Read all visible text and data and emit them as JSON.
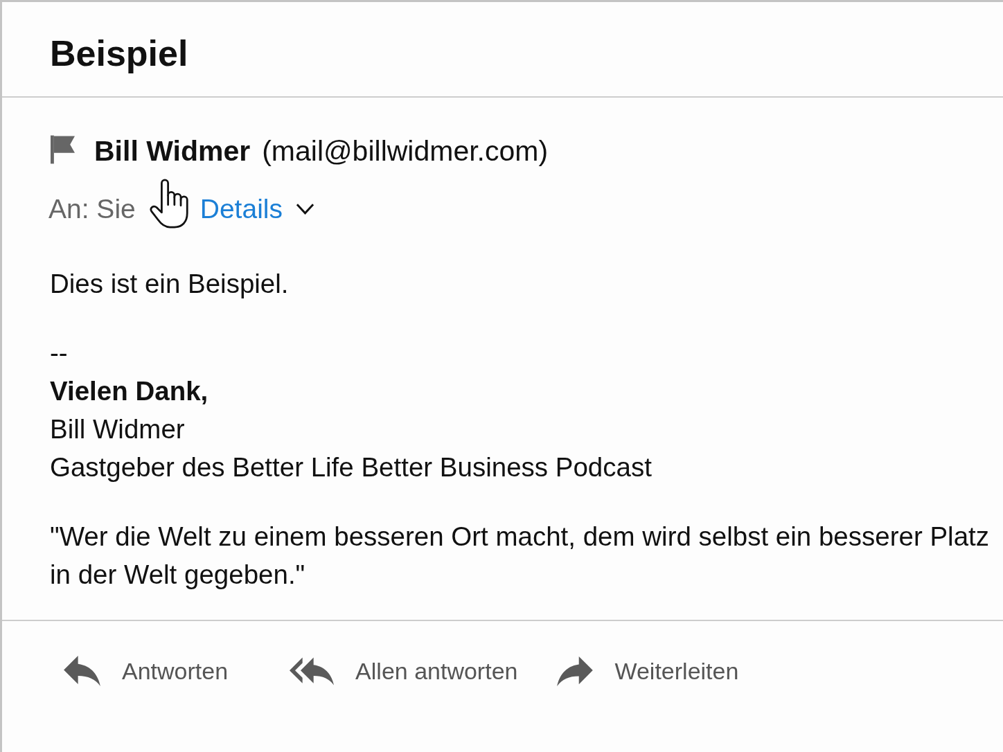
{
  "message": {
    "subject": "Beispiel",
    "sender": {
      "name": "Bill Widmer",
      "email": "(mail@billwidmer.com)"
    },
    "recipients": "An: Sie",
    "details": {
      "label": "Details",
      "expanded": false
    },
    "body": [
      {
        "lines": [
          {
            "text": "Dies ist ein Beispiel.",
            "bold": false
          }
        ]
      },
      {
        "lines": [
          {
            "text": "--",
            "bold": false
          },
          {
            "text": "Vielen Dank,",
            "bold": true
          },
          {
            "text": "Bill Widmer",
            "bold": false
          },
          {
            "text": "Gastgeber des Better Life Better Business Podcast",
            "bold": false
          }
        ]
      },
      {
        "lines": [
          {
            "text": "\"Wer die Welt zu einem besseren Ort macht, dem wird selbst ein besserer Platz in der Welt gegeben.\"",
            "bold": false
          }
        ]
      }
    ]
  },
  "actions": [
    {
      "kind": "reply",
      "label": "Antworten"
    },
    {
      "kind": "reply-all",
      "label": "Allen antworten"
    },
    {
      "kind": "forward",
      "label": "Weiterleiten"
    }
  ]
}
